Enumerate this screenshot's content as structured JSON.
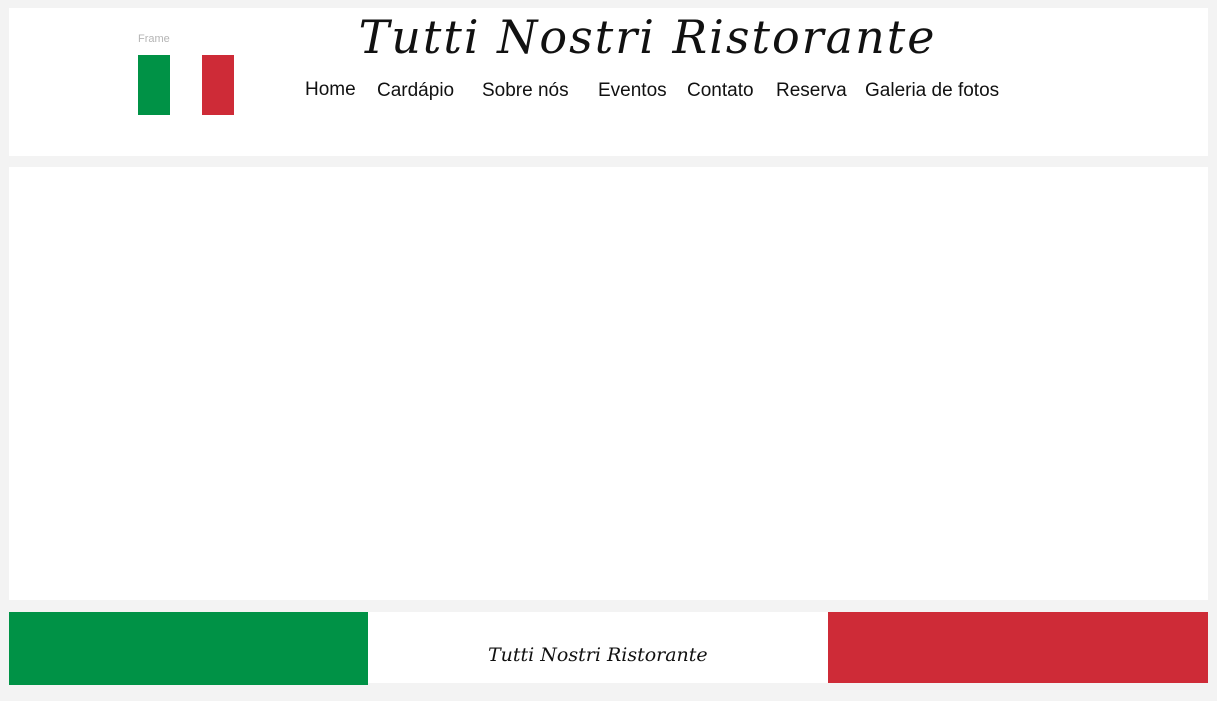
{
  "header": {
    "frame_label": "Frame",
    "title": "Tutti Nostri Ristorante",
    "nav": [
      {
        "label": "Home"
      },
      {
        "label": "Cardápio"
      },
      {
        "label": "Sobre nós"
      },
      {
        "label": "Eventos"
      },
      {
        "label": "Contato"
      },
      {
        "label": "Reserva"
      },
      {
        "label": "Galeria de fotos"
      }
    ]
  },
  "footer": {
    "title": "Tutti Nostri Ristorante"
  },
  "colors": {
    "flag_green": "#009246",
    "flag_white": "#ffffff",
    "flag_red": "#ce2b37",
    "page_background": "#f3f3f3",
    "card_background": "#ffffff",
    "text": "#111111"
  }
}
